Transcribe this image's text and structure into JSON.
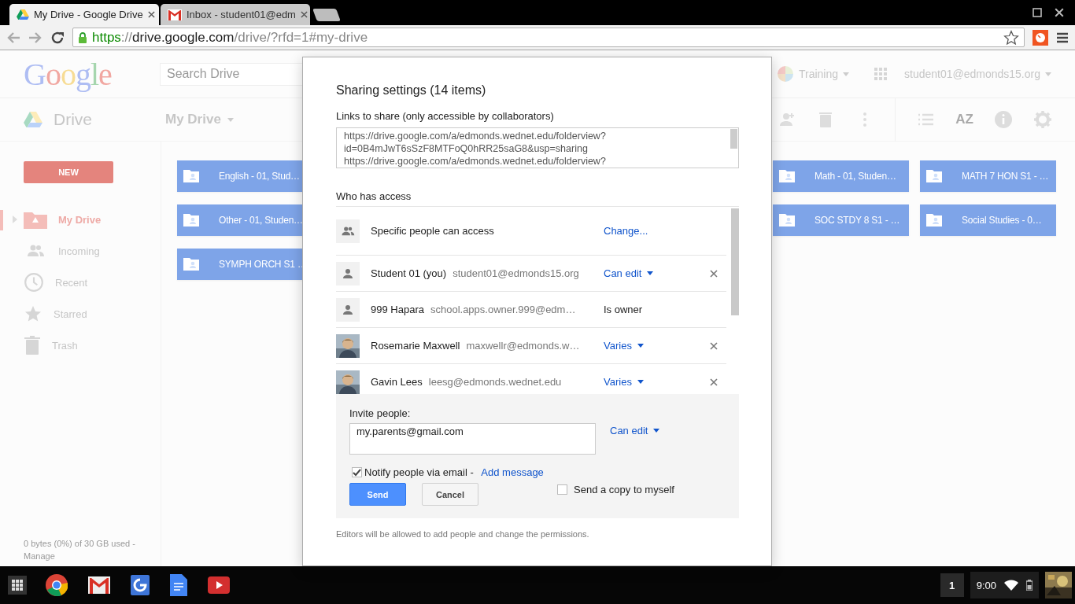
{
  "browser": {
    "tabs": [
      {
        "title": "My Drive - Google Drive",
        "selected": true
      },
      {
        "title": "Inbox - student01@edm",
        "selected": false
      }
    ],
    "url": {
      "scheme": "https",
      "separator": "://",
      "host": "drive.google.com",
      "path": "/drive/?rfd=1#my-drive"
    }
  },
  "drive": {
    "logo": "Google",
    "search": {
      "placeholder": "Search Drive"
    },
    "account_menu": "Training",
    "user": "student01@edmonds15.org",
    "app_name": "Drive",
    "location": "My Drive",
    "sort_button": "AZ",
    "new_button": "NEW",
    "sidebar": {
      "items": [
        {
          "label": "My Drive",
          "selected": true
        },
        {
          "label": "Incoming",
          "selected": false
        },
        {
          "label": "Recent",
          "selected": false
        },
        {
          "label": "Starred",
          "selected": false
        },
        {
          "label": "Trash",
          "selected": false
        }
      ],
      "storage": "0 bytes (0%) of 30 GB used -",
      "manage_link": "Manage"
    },
    "folders": [
      {
        "name": "English - 01, Stud…"
      },
      {
        "name": "Math - 01, Studen…"
      },
      {
        "name": "MATH 7 HON S1 - …"
      },
      {
        "name": "Other - 01, Studen…"
      },
      {
        "name": "SOC STDY 8 S1 - …"
      },
      {
        "name": "Social Studies - 0…"
      },
      {
        "name": "SYMPH ORCH S1 …"
      }
    ]
  },
  "dialog": {
    "title": "Sharing settings (14 items)",
    "links_label": "Links to share (only accessible by collaborators)",
    "links_lines": [
      "https://drive.google.com/a/edmonds.wednet.edu/folderview?",
      "id=0B4mJwT6sSzF8MTFoQ0hRR25saG8&usp=sharing",
      "https://drive.google.com/a/edmonds.wednet.edu/folderview?"
    ],
    "access_label": "Who has access",
    "access": [
      {
        "kind": "setting",
        "name": "Specific people can access",
        "action": "Change..."
      },
      {
        "kind": "person",
        "name": "Student 01 (you)",
        "email": "student01@edmonds15.org",
        "permission": "Can edit",
        "dropdown": true,
        "removable": true
      },
      {
        "kind": "person",
        "name": "999 Hapara",
        "email": "school.apps.owner.999@edm…",
        "permission": "Is owner",
        "dropdown": false,
        "removable": false
      },
      {
        "name": "Rosemarie Maxwell",
        "email": "maxwellr@edmonds.w…",
        "permission": "Varies",
        "dropdown": true,
        "removable": true
      },
      {
        "name": "Gavin Lees",
        "email": "leesg@edmonds.wednet.edu",
        "permission": "Varies",
        "dropdown": true,
        "removable": true
      }
    ],
    "invite": {
      "label": "Invite people:",
      "value": "my.parents@gmail.com",
      "permission": "Can edit",
      "notify": {
        "label": "Notify people via email -",
        "checked": true
      },
      "add_message": "Add message",
      "send": "Send",
      "cancel": "Cancel",
      "copy": {
        "label": "Send a copy to myself",
        "checked": false
      }
    },
    "footer": "Editors will be allowed to add people and change the permissions."
  },
  "shelf": {
    "notification_count": "1",
    "time": "9:00"
  }
}
